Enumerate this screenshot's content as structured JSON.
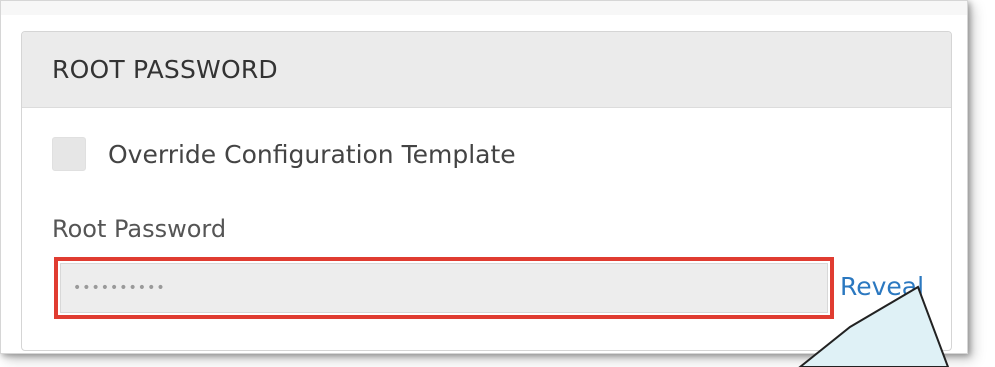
{
  "panel": {
    "title": "ROOT PASSWORD"
  },
  "override": {
    "label": "Override Configuration Template",
    "checked": false
  },
  "root_password": {
    "label": "Root Password",
    "masked_value": "••••••••••",
    "reveal_label": "Reveal"
  },
  "colors": {
    "highlight_border": "#e03c31",
    "link": "#2b78c0",
    "callout_fill": "#dff1f6"
  }
}
